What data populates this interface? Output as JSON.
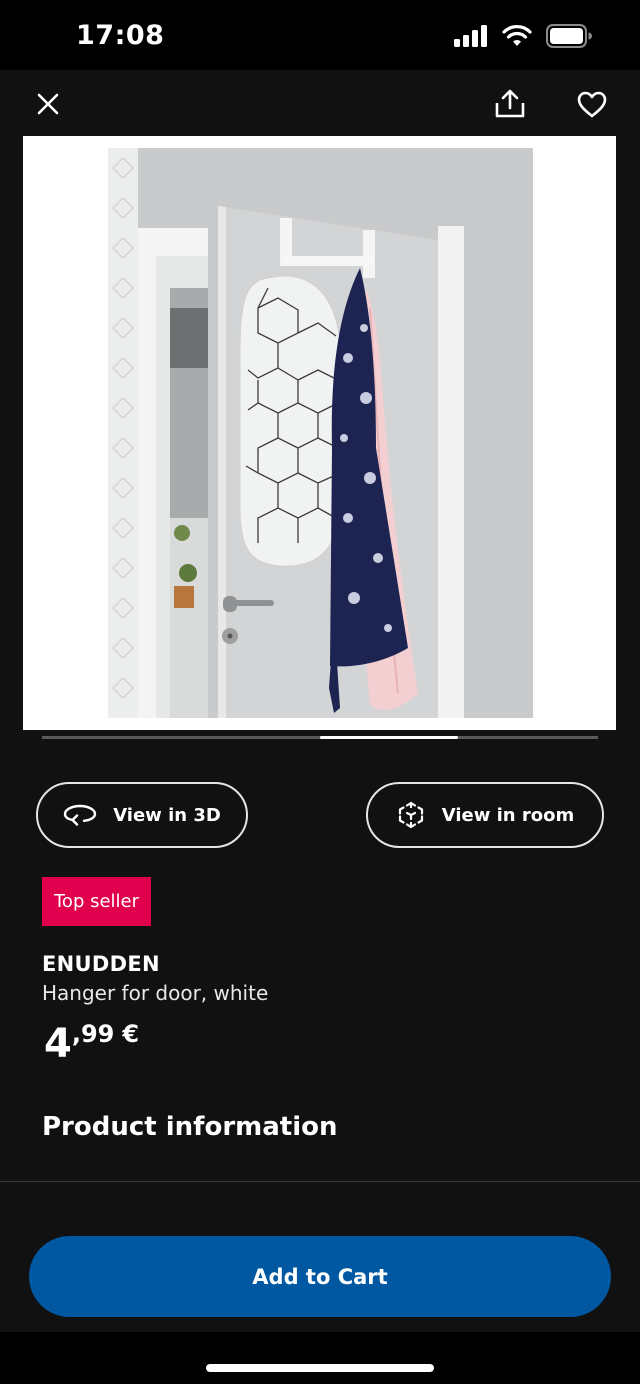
{
  "status_bar": {
    "time": "17:08",
    "icons": [
      "signal-icon",
      "wifi-icon",
      "battery-icon"
    ]
  },
  "topbar": {
    "icons": [
      "close-icon",
      "share-icon",
      "heart-icon"
    ]
  },
  "gallery": {
    "image_alt": "Hanger for door with ironing board, robe and slip dress",
    "current_position": 0.5
  },
  "actions": {
    "view_3d": "View in 3D",
    "view_room": "View in room"
  },
  "product": {
    "badge": "Top seller",
    "name": "ENUDDEN",
    "description": "Hanger for door, white",
    "price_main": "4",
    "price_decimals": ",99",
    "price_currency": "€"
  },
  "sections": {
    "product_info": "Product information"
  },
  "cart": {
    "label": "Add to Cart"
  },
  "colors": {
    "background": "#111112",
    "badge": "#e0004d",
    "cart_button": "#0058a3"
  }
}
